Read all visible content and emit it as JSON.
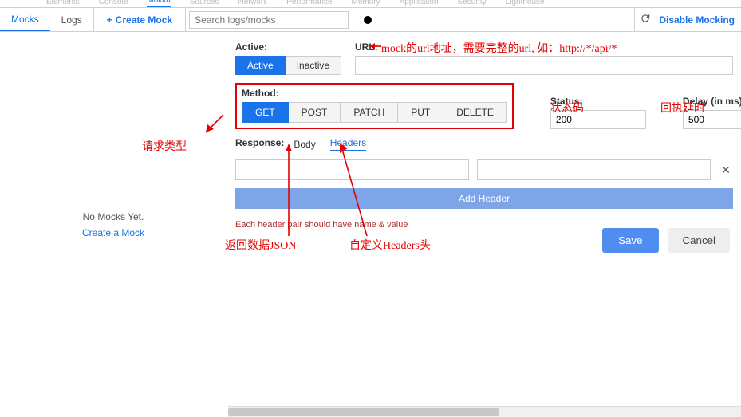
{
  "devtools_tabs": {
    "elements": "Elements",
    "console": "Console",
    "active": "Mokku",
    "sources": "Sources",
    "network": "Network",
    "performance": "Performance",
    "memory": "Memory",
    "application": "Application",
    "security": "Security",
    "lighthouse": "Lighthouse"
  },
  "toolbar": {
    "mocks_tab": "Mocks",
    "logs_tab": "Logs",
    "create": "Create Mock",
    "plus": "+",
    "search_placeholder": "Search logs/mocks",
    "disable": "Disable Mocking"
  },
  "left": {
    "empty": "No Mocks Yet.",
    "create_link": "Create a Mock"
  },
  "form": {
    "active_label": "Active:",
    "active_btn": "Active",
    "inactive_btn": "Inactive",
    "url_label": "URL:",
    "url_value": "",
    "method_label": "Method:",
    "methods": {
      "get": "GET",
      "post": "POST",
      "patch": "PATCH",
      "put": "PUT",
      "delete": "DELETE"
    },
    "status_label": "Status:",
    "status_value": "200",
    "delay_label": "Delay (in ms):",
    "delay_value": "500",
    "response_label": "Response:",
    "body_tab": "Body",
    "headers_tab": "Headers",
    "header_name": "",
    "header_value": "",
    "del_sym": "✕",
    "add_header": "Add Header",
    "hint": "Each header pair should have name & value",
    "save": "Save",
    "cancel": "Cancel"
  },
  "anno": {
    "url": "mock的url地址，需要完整的url, 如：http://*/api/*",
    "status": "状态码",
    "delay": "回执延时",
    "method": "请求类型",
    "body": "返回数据JSON",
    "headers": "自定义Headers头"
  }
}
